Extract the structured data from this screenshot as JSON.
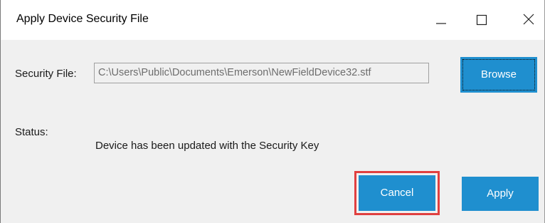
{
  "window": {
    "title": "Apply Device Security File",
    "controls": {
      "minimize": "minimize-icon",
      "maximize": "maximize-icon",
      "close": "close-icon"
    }
  },
  "form": {
    "file_label": "Security File:",
    "file_value": "C:\\Users\\Public\\Documents\\Emerson\\NewFieldDevice32.stf",
    "browse_label": "Browse",
    "status_label": "Status:",
    "status_text": "Device has been updated with the Security Key"
  },
  "actions": {
    "cancel_label": "Cancel",
    "apply_label": "Apply"
  },
  "colors": {
    "button": "#1f8fcf",
    "highlight": "#e04040",
    "background": "#f0f0f0"
  }
}
